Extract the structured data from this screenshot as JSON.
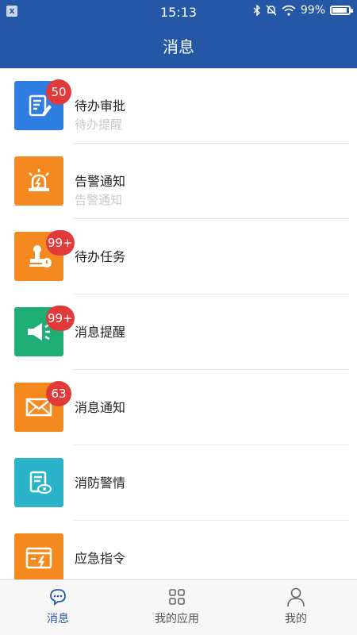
{
  "status_bar": {
    "close_glyph": "x",
    "time": "15:13",
    "battery": "99%",
    "icons": [
      "bluetooth-icon",
      "mute-icon",
      "wifi-icon",
      "battery-icon"
    ]
  },
  "header": {
    "title": "消息"
  },
  "items": [
    {
      "title": "待办审批",
      "subtitle": "待办提醒",
      "badge": "50",
      "icon": "edit-doc-icon",
      "color": "#2e7de0"
    },
    {
      "title": "告警通知",
      "subtitle": "告警通知",
      "badge": "",
      "icon": "alarm-light-icon",
      "color": "#f48a1f"
    },
    {
      "title": "待办任务",
      "subtitle": "",
      "badge": "99+",
      "icon": "stamp-icon",
      "color": "#f48a1f"
    },
    {
      "title": "消息提醒",
      "subtitle": "",
      "badge": "99+",
      "icon": "megaphone-icon",
      "color": "#1fae76"
    },
    {
      "title": "消息通知",
      "subtitle": "",
      "badge": "63",
      "icon": "mail-icon",
      "color": "#f48a1f"
    },
    {
      "title": "消防警情",
      "subtitle": "",
      "badge": "",
      "icon": "doc-eye-icon",
      "color": "#2bb3c9"
    },
    {
      "title": "应急指令",
      "subtitle": "",
      "badge": "",
      "icon": "emergency-card-icon",
      "color": "#f48a1f"
    }
  ],
  "tabbar": {
    "tabs": [
      {
        "label": "消息",
        "icon": "chat-icon",
        "active": true
      },
      {
        "label": "我的应用",
        "icon": "grid-icon",
        "active": false
      },
      {
        "label": "我的",
        "icon": "user-icon",
        "active": false
      }
    ]
  },
  "colors": {
    "primary": "#2557a7",
    "badge": "#e23a3a"
  }
}
